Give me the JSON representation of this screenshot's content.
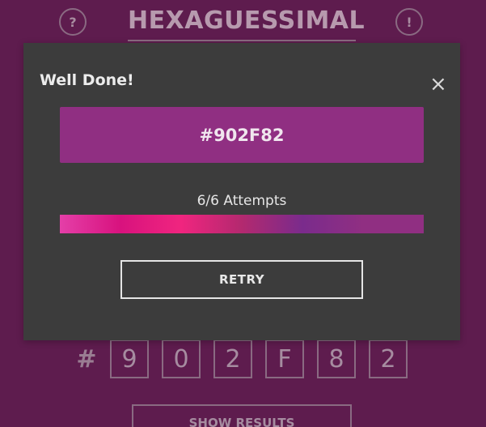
{
  "header": {
    "help_label": "?",
    "info_label": "!",
    "title": "HEXAGUESSIMAL"
  },
  "guess": {
    "hash": "#",
    "digits": [
      "9",
      "0",
      "2",
      "F",
      "8",
      "2"
    ]
  },
  "show_results_label": "SHOW RESULTS",
  "modal": {
    "title": "Well Done!",
    "close_label": "×",
    "target_hex": "#902F82",
    "target_color": "#902f82",
    "attempts_label": "6/6 Attempts",
    "attempt_colors": [
      "#e43fa8",
      "#d8127e",
      "#f0257f",
      "#b3296f",
      "#7a2b8c",
      "#902f82"
    ],
    "retry_label": "RETRY"
  },
  "colors": {
    "background": "#5e1c4e",
    "modal_background": "#3c3c3c"
  }
}
